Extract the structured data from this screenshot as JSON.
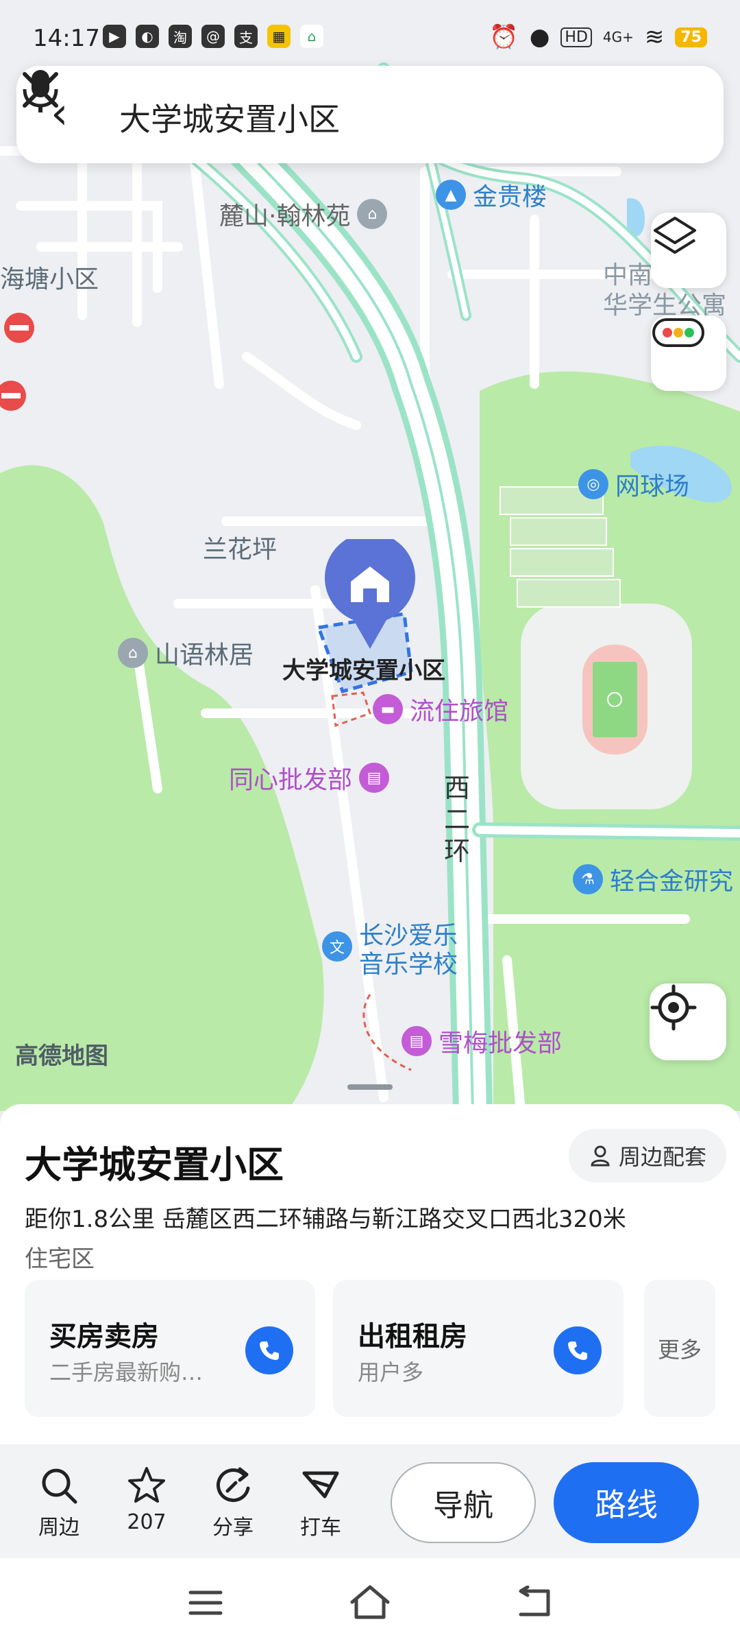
{
  "status_bar": {
    "time": "14:17",
    "battery": "75",
    "network": "4G+",
    "hd": "HD"
  },
  "search": {
    "query": "大学城安置小区"
  },
  "map": {
    "labels": {
      "lushan": "麓山·翰林苑",
      "jingui": "金贵楼",
      "haitang": "海塘小区",
      "zhonghua": "中南\n华学生公寓",
      "lanhuaping": "兰花坪",
      "shanyu": "山语林居",
      "target": "大学城安置小区",
      "liuzhu": "流住旅馆",
      "tongxin": "同心批发部",
      "wangqiu": "网球场",
      "xierhuan": "西二环",
      "qinghejin": "轻合金研究",
      "aile_line1": "长沙爱乐",
      "aile_line2": "音乐学校",
      "xuemei": "雪梅批发部"
    },
    "watermark": "高德地图"
  },
  "place": {
    "title": "大学城安置小区",
    "nearby_button": "周边配套",
    "address": "距你1.8公里  岳麓区西二环辅路与靳江路交叉口西北320米",
    "category": "住宅区",
    "cards": [
      {
        "title": "买房卖房",
        "subtitle": "二手房最新购…"
      },
      {
        "title": "出租租房",
        "subtitle": "用户多"
      }
    ],
    "more": "更多"
  },
  "actions": {
    "nearby": "周边",
    "favorite_count": "207",
    "share": "分享",
    "taxi": "打车",
    "navigate": "导航",
    "route": "路线"
  },
  "colors": {
    "primary": "#1f6ff2",
    "target_pin": "#5b73d6",
    "poi_blue": "#3d94e6",
    "poi_purple": "#b04fc8",
    "park_green": "#b4e8a8",
    "road_green": "#9be3c7"
  }
}
